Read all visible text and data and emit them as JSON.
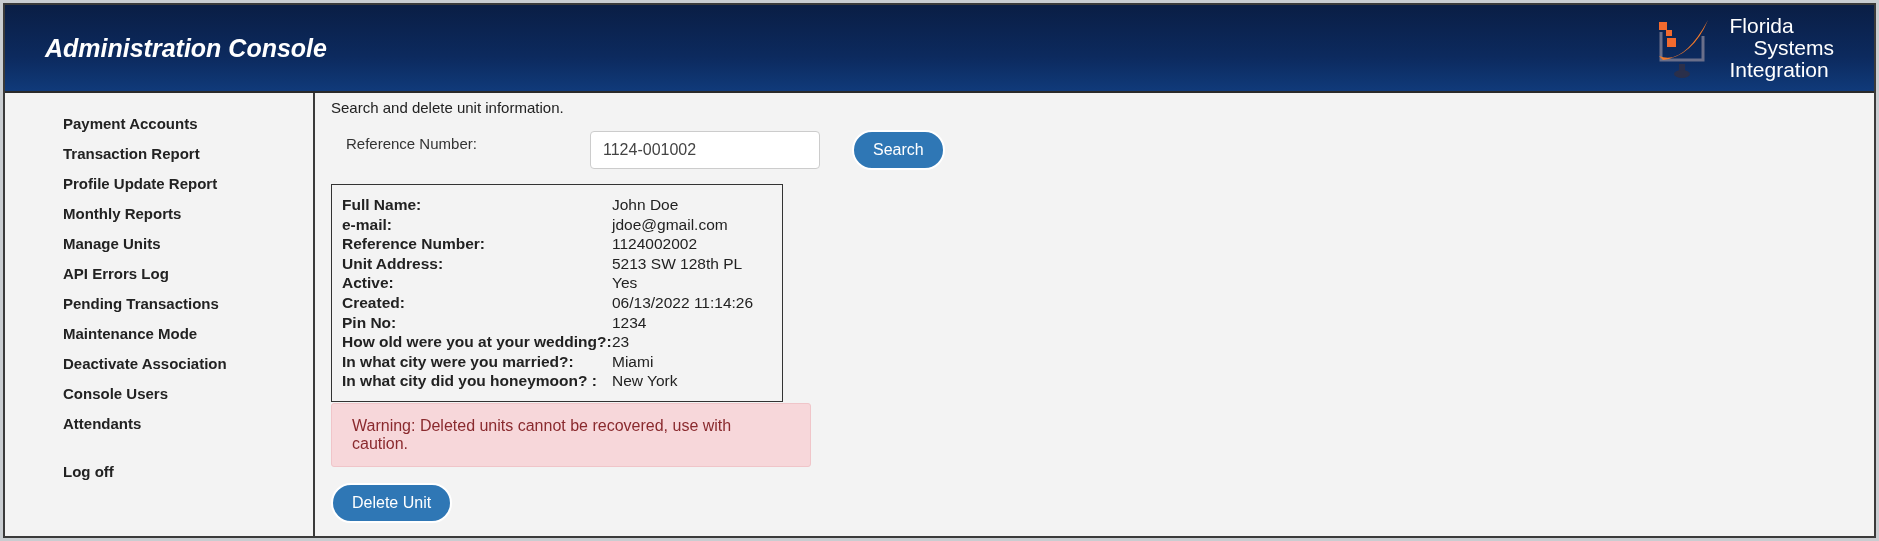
{
  "header": {
    "title": "Administration Console",
    "logo_lines": [
      "Florida",
      "Systems",
      "Integration"
    ]
  },
  "sidebar": {
    "items": [
      {
        "label": "Payment Accounts"
      },
      {
        "label": "Transaction Report"
      },
      {
        "label": "Profile Update Report"
      },
      {
        "label": "Monthly Reports"
      },
      {
        "label": "Manage Units"
      },
      {
        "label": "API Errors Log"
      },
      {
        "label": "Pending Transactions"
      },
      {
        "label": "Maintenance Mode"
      },
      {
        "label": "Deactivate Association"
      },
      {
        "label": "Console Users"
      },
      {
        "label": "Attendants"
      }
    ],
    "logoff": "Log off"
  },
  "main": {
    "intro": "Search and delete unit information.",
    "search_label": "Reference Number:",
    "search_value": "1124-001002",
    "search_button": "Search",
    "details": [
      {
        "label": "Full Name:",
        "value": "John Doe"
      },
      {
        "label": "e-mail:",
        "value": "jdoe@gmail.com"
      },
      {
        "label": "Reference Number:",
        "value": "1124002002"
      },
      {
        "label": "Unit Address:",
        "value": "5213 SW 128th PL"
      },
      {
        "label": "Active:",
        "value": "Yes"
      },
      {
        "label": "Created:",
        "value": "06/13/2022 11:14:26"
      },
      {
        "label": "Pin No:",
        "value": "1234"
      },
      {
        "label": "How old were you at your wedding?:",
        "value": "23"
      },
      {
        "label": "In what city were you married?:",
        "value": "Miami"
      },
      {
        "label": "In what city did you honeymoon? :",
        "value": "New York"
      }
    ],
    "warning": "Warning: Deleted units cannot be recovered, use with caution.",
    "delete_button": "Delete Unit"
  }
}
